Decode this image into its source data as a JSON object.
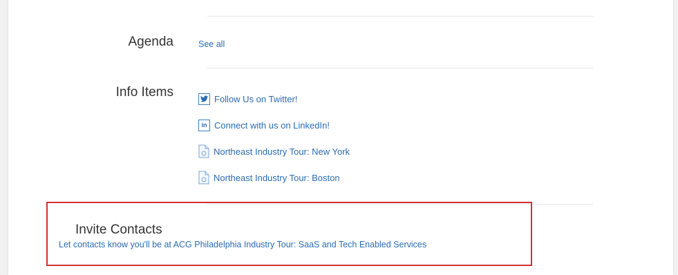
{
  "agenda": {
    "label": "Agenda",
    "see_all": "See all"
  },
  "info_items": {
    "label": "Info Items",
    "items": [
      {
        "text": "Follow Us on Twitter!",
        "icon": "twitter-icon"
      },
      {
        "text": "Connect with us on LinkedIn!",
        "icon": "linkedin-icon"
      },
      {
        "text": "Northeast Industry Tour: New York",
        "icon": "document-icon"
      },
      {
        "text": "Northeast Industry Tour: Boston",
        "icon": "document-icon"
      }
    ]
  },
  "invite": {
    "title": "Invite Contacts",
    "subtitle": "Let contacts know you'll be at ACG Philadelphia Industry Tour: SaaS and Tech Enabled Services"
  },
  "colors": {
    "link": "#2b6cb3",
    "highlight": "#d32f2f"
  }
}
